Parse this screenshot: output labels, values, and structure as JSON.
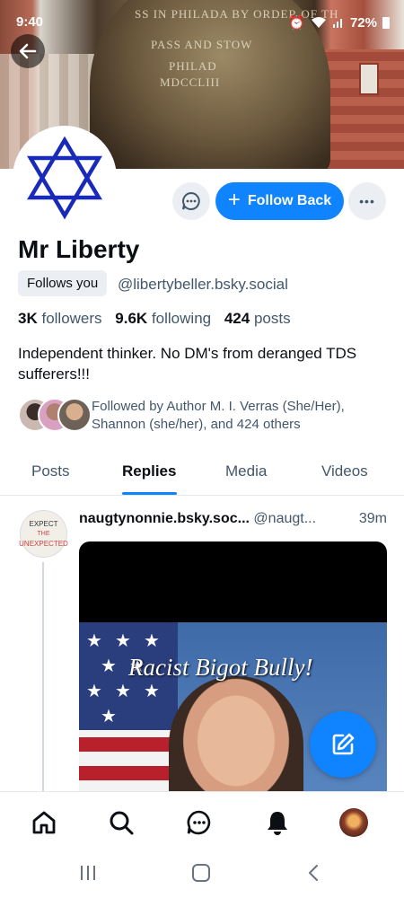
{
  "status_bar": {
    "time": "9:40",
    "battery": "72%"
  },
  "banner": {
    "bell_text_1": "SS IN PHILADA BY ORDER OF TH",
    "bell_text_2": "PASS AND STOW",
    "bell_text_3": "PHILAD",
    "bell_text_4": "MDCCLIII"
  },
  "profile": {
    "display_name": "Mr Liberty",
    "follows_you_label": "Follows you",
    "handle": "@libertybeller.bsky.social",
    "followers_count": "3K",
    "followers_label": "followers",
    "following_count": "9.6K",
    "following_label": "following",
    "posts_count": "424",
    "posts_label": "posts",
    "bio": "Independent thinker. No DM's from deranged TDS sufferers!!!",
    "followed_by": "Followed by Author M. I. Verras (She/Her), Shannon (she/her), and 424 others"
  },
  "actions": {
    "follow_back_label": "Follow Back",
    "follow_back_icon": "+",
    "more_icon": "•••"
  },
  "tabs": [
    {
      "label": "Posts",
      "active": false
    },
    {
      "label": "Replies",
      "active": true
    },
    {
      "label": "Media",
      "active": false
    },
    {
      "label": "Videos",
      "active": false
    }
  ],
  "post": {
    "avatar_text_top": "EXPECT",
    "avatar_text_mid": "THE",
    "avatar_text_bottom": "UNEXPECTED",
    "author": "naugtynonnie.bsky.soc...",
    "handle": "@naugt...",
    "time": "39m",
    "media_caption": "Racist Bigot Bully!"
  },
  "colors": {
    "accent": "#1083fe",
    "muted_text": "#42576c",
    "button_bg": "#ebeef2"
  },
  "icons": {
    "back": "arrow-left-icon",
    "message": "chat-bubble-icon",
    "compose": "pencil-square-icon",
    "nav": [
      "home-icon",
      "search-icon",
      "chat-icon",
      "bell-icon",
      "avatar"
    ]
  }
}
